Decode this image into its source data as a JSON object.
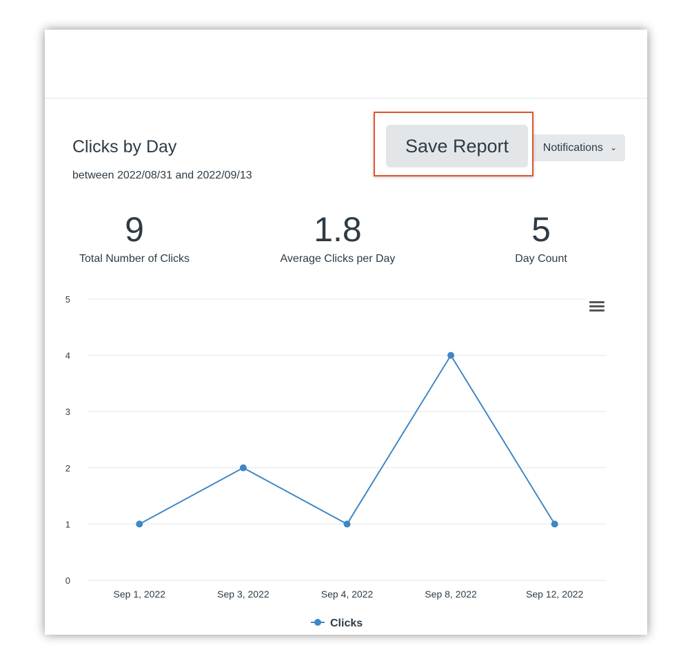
{
  "report": {
    "title": "Clicks by Day",
    "date_range": "between 2022/08/31 and 2022/09/13",
    "save_button": "Save Report",
    "notifications_button": "Notifications",
    "menu_icon": "hamburger-menu-icon"
  },
  "stats": [
    {
      "value": "9",
      "label": "Total Number of Clicks"
    },
    {
      "value": "1.8",
      "label": "Average Clicks per Day"
    },
    {
      "value": "5",
      "label": "Day Count"
    }
  ],
  "chart_data": {
    "type": "line",
    "categories": [
      "Sep 1, 2022",
      "Sep 3, 2022",
      "Sep 4, 2022",
      "Sep 8, 2022",
      "Sep 12, 2022"
    ],
    "series": [
      {
        "name": "Clicks",
        "values": [
          1,
          2,
          1,
          4,
          1
        ]
      }
    ],
    "y_ticks": [
      "0",
      "1",
      "2",
      "3",
      "4",
      "5"
    ],
    "ylim": [
      0,
      5
    ],
    "grid": true,
    "legend": "bottom-center",
    "colors": {
      "line": "#3f87c6",
      "grid": "#e6e6e6"
    }
  }
}
